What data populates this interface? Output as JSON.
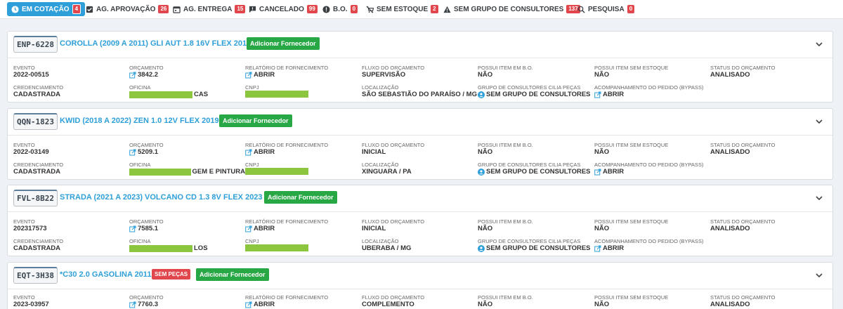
{
  "tabs": [
    {
      "label": "EM COTAÇÃO",
      "count": "4",
      "icon": "clock-icon",
      "active": true
    },
    {
      "label": "AG. APROVAÇÃO",
      "count": "26",
      "icon": "checkbox-icon"
    },
    {
      "label": "AG. ENTREGA",
      "count": "15",
      "icon": "calendar-icon"
    },
    {
      "label": "CANCELADO",
      "count": "99",
      "icon": "message-alert-icon"
    },
    {
      "label": "B.O.",
      "count": "0",
      "icon": "alert-circle-icon"
    },
    {
      "label": "SEM ESTOQUE",
      "count": "2",
      "icon": "cart-off-icon"
    },
    {
      "label": "SEM GRUPO DE CONSULTORES",
      "count": "137",
      "icon": "warning-icon"
    },
    {
      "label": "PESQUISA",
      "count": "0",
      "icon": "search-icon"
    }
  ],
  "labels": {
    "evento": "EVENTO",
    "orcamento": "ORÇAMENTO",
    "relatorio": "RELATÓRIO DE FORNECIMENTO",
    "fluxo": "FLUXO DO ORÇAMENTO",
    "bo": "POSSUI ITEM EM B.O.",
    "sem_estoque": "POSSUI ITEM SEM ESTOQUE",
    "status": "STATUS DO ORÇAMENTO",
    "credenciamento": "CREDENCIAMENTO",
    "oficina": "OFICINA",
    "cnpj": "CNPJ",
    "localizacao": "LOCALIZAÇÃO",
    "grupo": "GRUPO DE CONSULTORES CILIA PEÇAS",
    "acompanhamento": "ACOMPANHAMENTO DO PEDIDO (BYPASS)"
  },
  "add_supplier_label": "Adicionar Fornecedor",
  "cards": [
    {
      "plate": "ENP-6228",
      "title": "COROLLA (2009 A 2011) GLI AUT 1.8 16V FLEX 2011",
      "evento": "2022-00515",
      "orcamento": "3842.2",
      "relatorio": "ABRIR",
      "fluxo": "SUPERVISÃO",
      "bo": "NÃO",
      "sem_estoque": "NÃO",
      "status": "ANALISADO",
      "credenciamento": "CADASTRADA",
      "oficina_suffix": "CAS",
      "localizacao": "SÃO SEBASTIÃO DO PARAÍSO / MG",
      "grupo": "SEM GRUPO DE CONSULTORES",
      "acompanhamento": "ABRIR"
    },
    {
      "plate": "QQN-1823",
      "title": "KWID (2018 A 2022) ZEN 1.0 12V FLEX 2019",
      "evento": "2022-03149",
      "orcamento": "5209.1",
      "relatorio": "ABRIR",
      "fluxo": "INICIAL",
      "bo": "NÃO",
      "sem_estoque": "NÃO",
      "status": "ANALISADO",
      "credenciamento": "CADASTRADA",
      "oficina_suffix": "GEM E PINTURA",
      "localizacao": "XINGUARA / PA",
      "grupo": "SEM GRUPO DE CONSULTORES",
      "acompanhamento": "ABRIR"
    },
    {
      "plate": "FVL-8B22",
      "title": "STRADA (2021 A 2023) VOLCANO CD 1.3 8V FLEX 2023",
      "evento": "202317573",
      "orcamento": "7585.1",
      "relatorio": "ABRIR",
      "fluxo": "INICIAL",
      "bo": "NÃO",
      "sem_estoque": "NÃO",
      "status": "ANALISADO",
      "credenciamento": "CADASTRADA",
      "oficina_suffix": "LOS",
      "localizacao": "UBERABA / MG",
      "grupo": "SEM GRUPO DE CONSULTORES",
      "acompanhamento": "ABRIR"
    },
    {
      "plate": "EQT-3H38",
      "title": "*C30 2.0 GASOLINA 2011",
      "sem_pecas": "SEM PEÇAS",
      "evento": "2023-03957",
      "orcamento": "7760.3",
      "relatorio": "ABRIR",
      "fluxo": "COMPLEMENTO",
      "bo": "NÃO",
      "sem_estoque": "NÃO",
      "status": "ANALISADO"
    }
  ],
  "colors": {
    "accent": "#2e9fd8",
    "success": "#28a745",
    "danger": "#e0464c",
    "redaction": "#8cc63f"
  }
}
